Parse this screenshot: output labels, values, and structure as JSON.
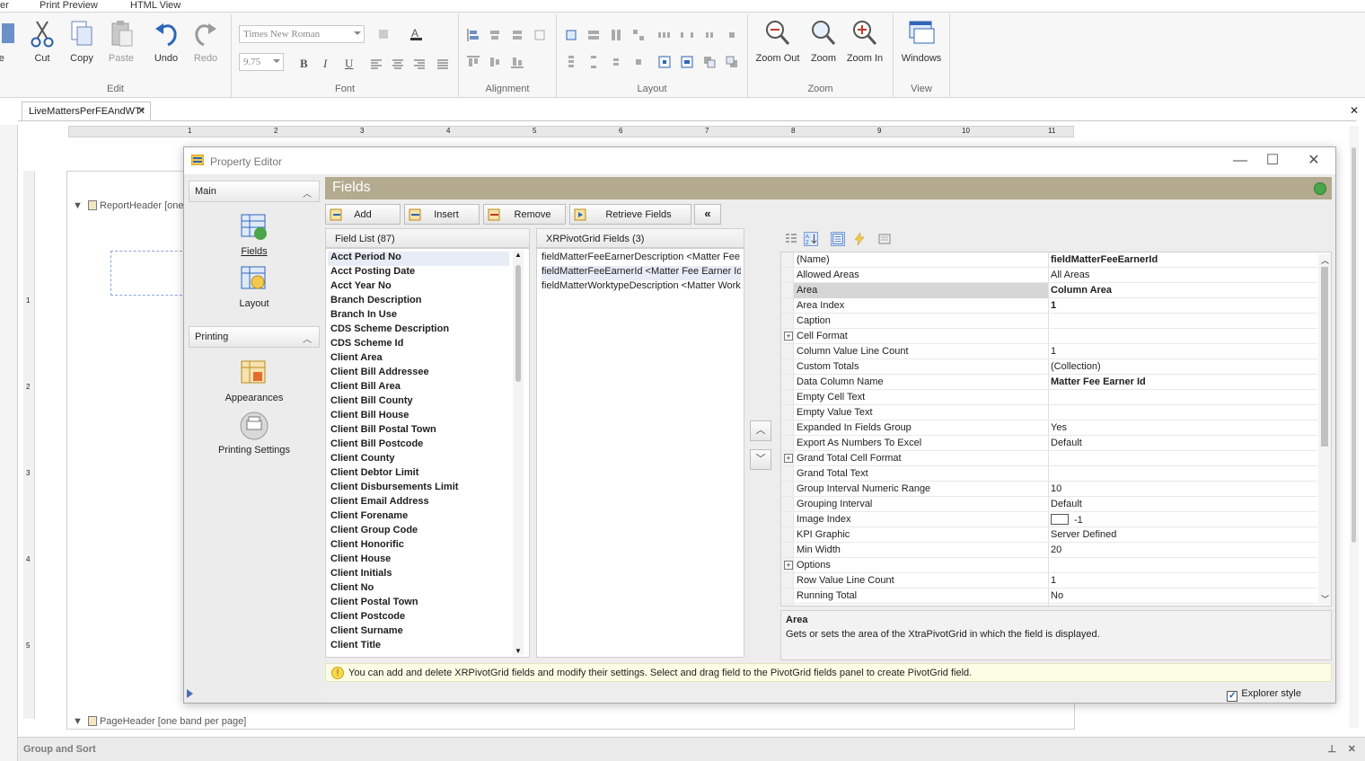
{
  "ribbon": {
    "tabs": [
      "er",
      "Print Preview",
      "HTML View"
    ],
    "edit_group": {
      "label": "Edit",
      "buttons": [
        {
          "label": "re"
        },
        {
          "label": "Cut"
        },
        {
          "label": "Copy"
        },
        {
          "label": "Paste"
        },
        {
          "label": "Undo"
        },
        {
          "label": "Redo"
        }
      ]
    },
    "font_group": {
      "label": "Font",
      "font_name": "Times New Roman",
      "font_size": "9.75",
      "bold": "B",
      "italic": "I",
      "underline": "U"
    },
    "alignment_group": {
      "label": "Alignment"
    },
    "layout_group": {
      "label": "Layout"
    },
    "zoom_group": {
      "label": "Zoom",
      "buttons": [
        {
          "label": "Zoom Out"
        },
        {
          "label": "Zoom"
        },
        {
          "label": "Zoom In"
        }
      ]
    },
    "view_group": {
      "label": "View",
      "windows_label": "Windows"
    }
  },
  "document": {
    "tab_label": "LiveMattersPerFEAndWT*",
    "ruler_numbers": [
      "1",
      "2",
      "3",
      "4",
      "5",
      "6",
      "7",
      "8",
      "9",
      "10",
      "11"
    ],
    "vruler_numbers": [
      "1",
      "2",
      "3",
      "4",
      "5"
    ],
    "report_header_band": "ReportHeader [one",
    "page_header_band": "PageHeader [one band per page]",
    "group_and_sort": "Group and Sort"
  },
  "editor": {
    "title": "Property Editor",
    "nav": {
      "main_header": "Main",
      "main_items": [
        {
          "label": "Fields"
        },
        {
          "label": "Layout"
        }
      ],
      "printing_header": "Printing",
      "printing_items": [
        {
          "label": "Appearances"
        },
        {
          "label": "Printing Settings"
        }
      ]
    },
    "panel_title": "Fields",
    "toolbar": {
      "add": "Add",
      "insert": "Insert",
      "remove": "Remove",
      "retrieve": "Retrieve Fields",
      "collapse": "«"
    },
    "field_list": {
      "header": "Field List (87)",
      "items": [
        "Acct Period No",
        "Acct Posting Date",
        "Acct Year No",
        "Branch Description",
        "Branch In Use",
        "CDS Scheme Description",
        "CDS Scheme Id",
        "Client Area",
        "Client Bill Addressee",
        "Client Bill Area",
        "Client Bill County",
        "Client Bill House",
        "Client Bill Postal Town",
        "Client Bill Postcode",
        "Client County",
        "Client Debtor Limit",
        "Client Disbursements Limit",
        "Client Email Address",
        "Client Forename",
        "Client Group Code",
        "Client Honorific",
        "Client House",
        "Client Initials",
        "Client No",
        "Client Postal Town",
        "Client Postcode",
        "Client Surname",
        "Client Title"
      ]
    },
    "pivot_fields": {
      "header": "XRPivotGrid Fields (3)",
      "items": [
        "fieldMatterFeeEarnerDescription <Matter Fee Earner Description>",
        "fieldMatterFeeEarnerId <Matter Fee Earner Id>",
        "fieldMatterWorktypeDescription <Matter Worktype Description>"
      ]
    },
    "properties": [
      {
        "name": "(Name)",
        "value": "fieldMatterFeeEarnerId",
        "bold": true
      },
      {
        "name": "Allowed Areas",
        "value": "All Areas"
      },
      {
        "name": "Area",
        "value": "Column Area",
        "bold": true,
        "selected": true
      },
      {
        "name": "Area Index",
        "value": "1",
        "bold": true
      },
      {
        "name": "Caption",
        "value": ""
      },
      {
        "name": "Cell Format",
        "value": "",
        "expandable": true
      },
      {
        "name": "Column Value Line Count",
        "value": "1"
      },
      {
        "name": "Custom Totals",
        "value": "(Collection)"
      },
      {
        "name": "Data Column Name",
        "value": "Matter Fee Earner Id",
        "bold": true
      },
      {
        "name": "Empty Cell Text",
        "value": ""
      },
      {
        "name": "Empty Value Text",
        "value": ""
      },
      {
        "name": "Expanded In Fields Group",
        "value": "Yes"
      },
      {
        "name": "Export As Numbers To Excel",
        "value": "Default"
      },
      {
        "name": "Grand Total Cell Format",
        "value": "",
        "expandable": true
      },
      {
        "name": "Grand Total Text",
        "value": ""
      },
      {
        "name": "Group Interval Numeric Range",
        "value": "10"
      },
      {
        "name": "Grouping Interval",
        "value": "Default"
      },
      {
        "name": "Image Index",
        "value": "-1",
        "swatch": true
      },
      {
        "name": "KPI Graphic",
        "value": "Server Defined"
      },
      {
        "name": "Min Width",
        "value": "20"
      },
      {
        "name": "Options",
        "value": "",
        "expandable": true
      },
      {
        "name": "Row Value Line Count",
        "value": "1"
      },
      {
        "name": "Running Total",
        "value": "No"
      }
    ],
    "description": {
      "title": "Area",
      "text": "Gets or sets the area of the XtraPivotGrid in which the field is displayed."
    },
    "hint": "You can add and delete XRPivotGrid fields and modify their settings. Select and drag field to the PivotGrid fields panel to create PivotGrid field.",
    "explorer_style": {
      "label": "Explorer style",
      "checked": true
    }
  },
  "colors": {
    "panel_header": "#b3aa8f",
    "selection": "#e8ecf6",
    "hint_background": "#fdfde6"
  }
}
